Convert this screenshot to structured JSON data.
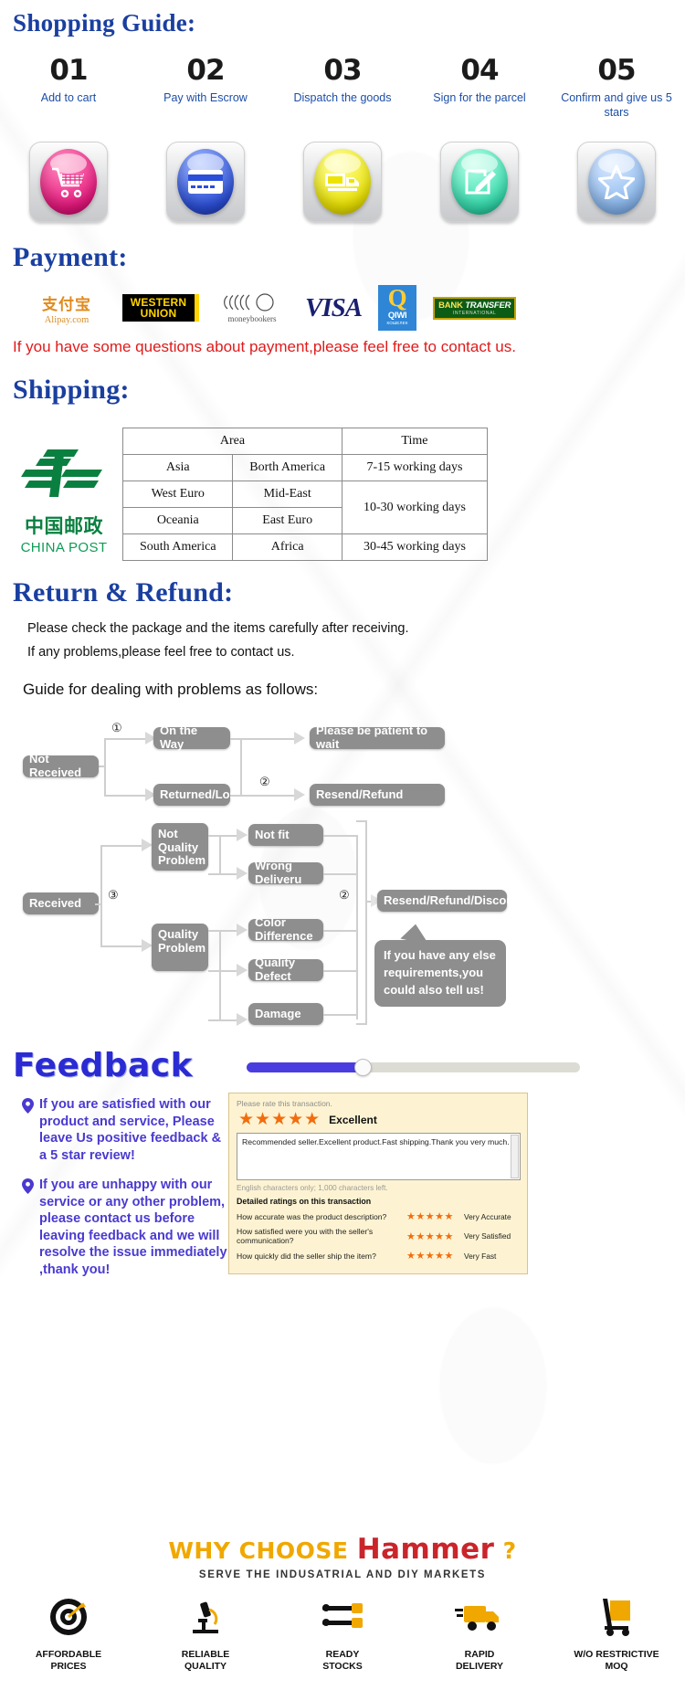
{
  "shopping_guide": {
    "title": "Shopping Guide:",
    "steps": [
      {
        "num": "01",
        "label": "Add to cart",
        "icon": "cart-icon"
      },
      {
        "num": "02",
        "label": "Pay with Escrow",
        "icon": "credit-card-icon"
      },
      {
        "num": "03",
        "label": "Dispatch the goods",
        "icon": "truck-icon"
      },
      {
        "num": "04",
        "label": "Sign for the parcel",
        "icon": "sign-document-icon"
      },
      {
        "num": "05",
        "label": "Confirm and give us 5 stars",
        "icon": "star-icon"
      }
    ]
  },
  "payment": {
    "title": "Payment:",
    "note": "If you have some questions about payment,please feel free to contact us.",
    "logos": [
      {
        "name": "alipay",
        "zh": "支付宝",
        "en": "Alipay.com"
      },
      {
        "name": "western-union",
        "line1": "WESTERN",
        "line2": "UNION"
      },
      {
        "name": "moneybookers",
        "text": "moneybookers"
      },
      {
        "name": "visa",
        "text": "VISA"
      },
      {
        "name": "qiwi",
        "q": "Q",
        "text": "QIWI",
        "sub": "КОШЕЛЕК"
      },
      {
        "name": "bank-transfer",
        "t1a": "BANK ",
        "t1b": "TRANSFER",
        "t2": "INTERNATIONAL"
      }
    ]
  },
  "shipping": {
    "title": "Shipping:",
    "carrier": {
      "zh": "中国邮政",
      "en": "CHINA POST"
    },
    "table": {
      "headers": [
        "Area",
        "Time"
      ],
      "rows": [
        {
          "a": "Asia",
          "b": "Borth America",
          "time": "7-15 working days"
        },
        {
          "a": "West Euro",
          "b": "Mid-East",
          "time": "10-30 working days"
        },
        {
          "a": "Oceania",
          "b": "East Euro",
          "time": ""
        },
        {
          "a": "South America",
          "b": "Africa",
          "time": "30-45 working days"
        }
      ]
    }
  },
  "return_refund": {
    "title": "Return & Refund:",
    "line1": "Please check the package and the items carefully after receiving.",
    "line2": "If any problems,please feel free to contact us.",
    "guide_heading": "Guide for dealing with problems as follows:"
  },
  "flowchart": {
    "not_received": "Not Received",
    "on_the_way": "On the Way",
    "returned_lost": "Returned/Lost",
    "please_wait": "Please be patient to wait",
    "resend_refund": "Resend/Refund",
    "received": "Received",
    "not_quality_problem": "Not Quality Problem",
    "quality_problem": "Quality Problem",
    "not_fit": "Not fit",
    "wrong_delivery": "Wrong Deliveru",
    "color_difference": "Color Difference",
    "quality_defect": "Quality Defect",
    "damage": "Damage",
    "resend_refund_discount": "Resend/Refund/Discount",
    "bubble": "If you have any else requirements,you could also tell us!",
    "marks": {
      "one": "①",
      "two": "②",
      "three": "③"
    }
  },
  "feedback": {
    "title": "Feedback",
    "left_items": [
      "If you are satisfied with our product and service, Please leave Us positive feedback & a 5 star review!",
      "If you are unhappy with our service or any other problem, please contact us before leaving feedback and we will resolve the issue immediately ,thank you!"
    ],
    "review": {
      "prompt": "Please rate this transaction.",
      "stars": "★★★★★",
      "rating_label": "Excellent",
      "comment": "Recommended seller.Excellent product.Fast shipping.Thank you very much.",
      "char_note": "English characters only; 1,000 characters left.",
      "details_heading": "Detailed ratings on this transaction",
      "rows": [
        {
          "question": "How accurate was the product description?",
          "stars": "★★★★★",
          "label": "Very Accurate"
        },
        {
          "question": "How satisfied were you with the seller's communication?",
          "stars": "★★★★★",
          "label": "Very Satisfied"
        },
        {
          "question": "How quickly did the seller ship the item?",
          "stars": "★★★★★",
          "label": "Very Fast"
        }
      ]
    }
  },
  "footer": {
    "why_pre": "WHY CHOOSE ",
    "why_brand": "Hammer",
    "why_post": " ?",
    "tagline": "SERVE THE INDUSATRIAL AND DIY MARKETS",
    "features": [
      {
        "icon": "target-icon",
        "l1": "AFFORDABLE",
        "l2": "PRICES"
      },
      {
        "icon": "microscope-icon",
        "l1": "RELIABLE",
        "l2": "QUALITY"
      },
      {
        "icon": "tools-icon",
        "l1": "READY",
        "l2": "STOCKS"
      },
      {
        "icon": "truck-icon",
        "l1": "RAPID",
        "l2": "DELIVERY"
      },
      {
        "icon": "hand-truck-icon",
        "l1": "W/O RESTRICTIVE",
        "l2": "MOQ"
      }
    ]
  },
  "colors": {
    "heading_blue": "#1a3fa0",
    "red_note": "#e01b1b",
    "feedback_blue": "#2b2bd4",
    "star_orange": "#f26c0d",
    "brand_yellow": "#f0a800"
  }
}
